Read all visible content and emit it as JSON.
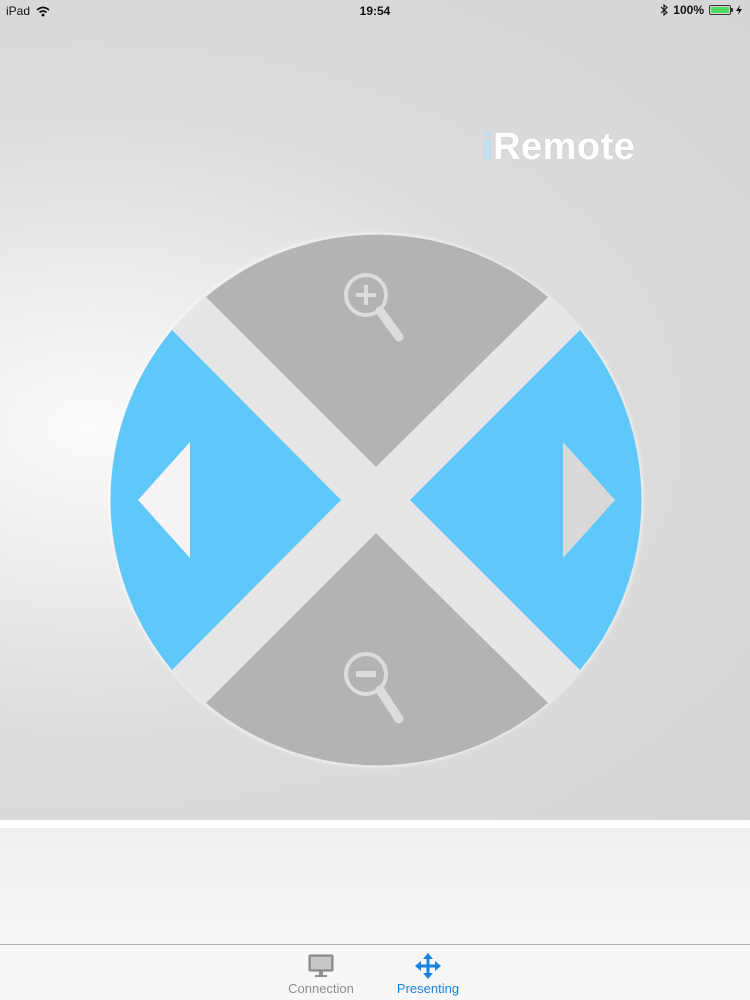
{
  "status_bar": {
    "device": "iPad",
    "time": "19:54",
    "battery": "100%",
    "battery_level": 1.0,
    "icons": [
      "wifi-icon",
      "bluetooth-icon",
      "battery-icon",
      "charging-icon"
    ]
  },
  "app": {
    "title_prefix": "i",
    "title_rest": "Remote"
  },
  "controls": {
    "zoom_in": "zoom-in-icon",
    "zoom_out": "zoom-out-icon",
    "previous": "arrow-left-icon",
    "next": "arrow-right-icon"
  },
  "colors": {
    "accent_blue": "#5ec8fb",
    "segment_gray": "#b3b3b3",
    "tab_active": "#1a82e0",
    "tab_inactive": "#8e8e93"
  },
  "tabs": [
    {
      "label": "Connection",
      "icon": "monitor-icon",
      "active": false
    },
    {
      "label": "Presenting",
      "icon": "move-arrows-icon",
      "active": true
    }
  ]
}
